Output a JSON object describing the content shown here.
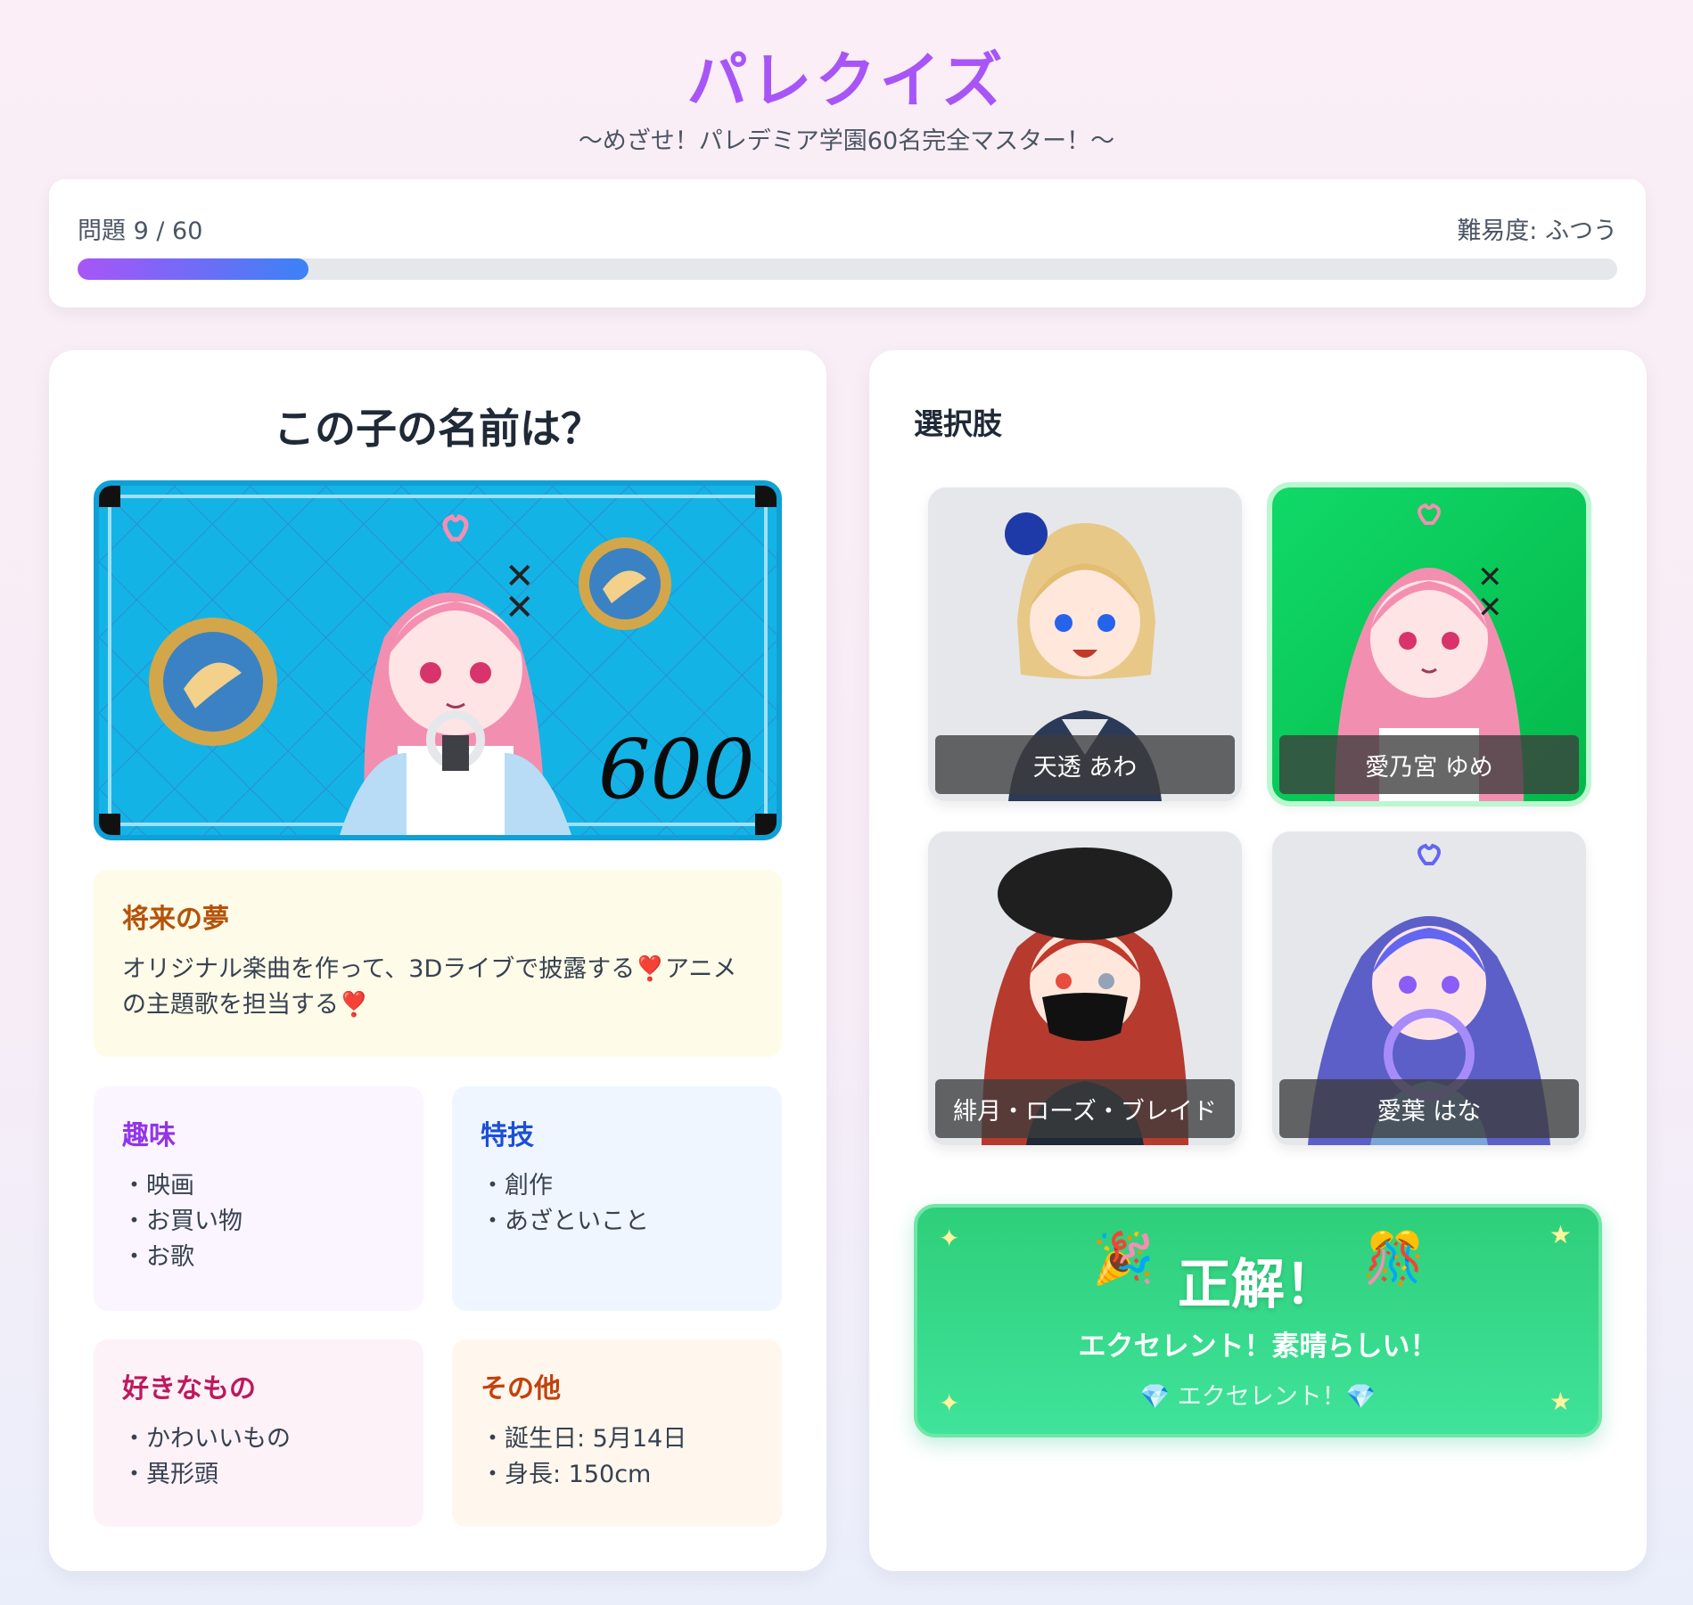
{
  "header": {
    "title": "パレクイズ",
    "subtitle": "〜めざせ！パレデミア学園60名完全マスター！〜"
  },
  "progress": {
    "label": "問題 9 / 60",
    "current": 9,
    "total": 60,
    "difficulty": "難易度: ふつう",
    "fill_fraction": 0.15,
    "fill_color_start": "#a855f7",
    "fill_color_end": "#3b82f6"
  },
  "question": {
    "title": "この子の名前は？",
    "portrait_badge_text": "600"
  },
  "profile": {
    "dream": {
      "title": "将来の夢",
      "text": "オリジナル楽曲を作って、3Dライブで披露する❣️アニメの主題歌を担当する❣️"
    },
    "hobby": {
      "title": "趣味",
      "items": [
        "映画",
        "お買い物",
        "お歌"
      ]
    },
    "skill": {
      "title": "特技",
      "items": [
        "創作",
        "あざといこと"
      ]
    },
    "likes": {
      "title": "好きなもの",
      "items": [
        "かわいいもの",
        "異形頭"
      ]
    },
    "other": {
      "title": "その他",
      "items": [
        "誕生日: 5月14日",
        "身長: 150cm"
      ]
    }
  },
  "choices": {
    "title": "選択肢",
    "options": [
      {
        "name": "天透 あわ",
        "state": "default"
      },
      {
        "name": "愛乃宮 ゆめ",
        "state": "correct"
      },
      {
        "name": "緋月・ローズ・ブレイド",
        "state": "default"
      },
      {
        "name": "愛葉 はな",
        "state": "default"
      }
    ]
  },
  "result": {
    "title": "正解！",
    "message": "エクセレント！素晴らしい！",
    "sub": "💎 エクセレント！💎",
    "emoji_left": "🎉",
    "emoji_right": "🎊"
  },
  "colors": {
    "accent": "#a855f7",
    "correct": "#10d968",
    "portrait_bg": "#14b3e6"
  }
}
